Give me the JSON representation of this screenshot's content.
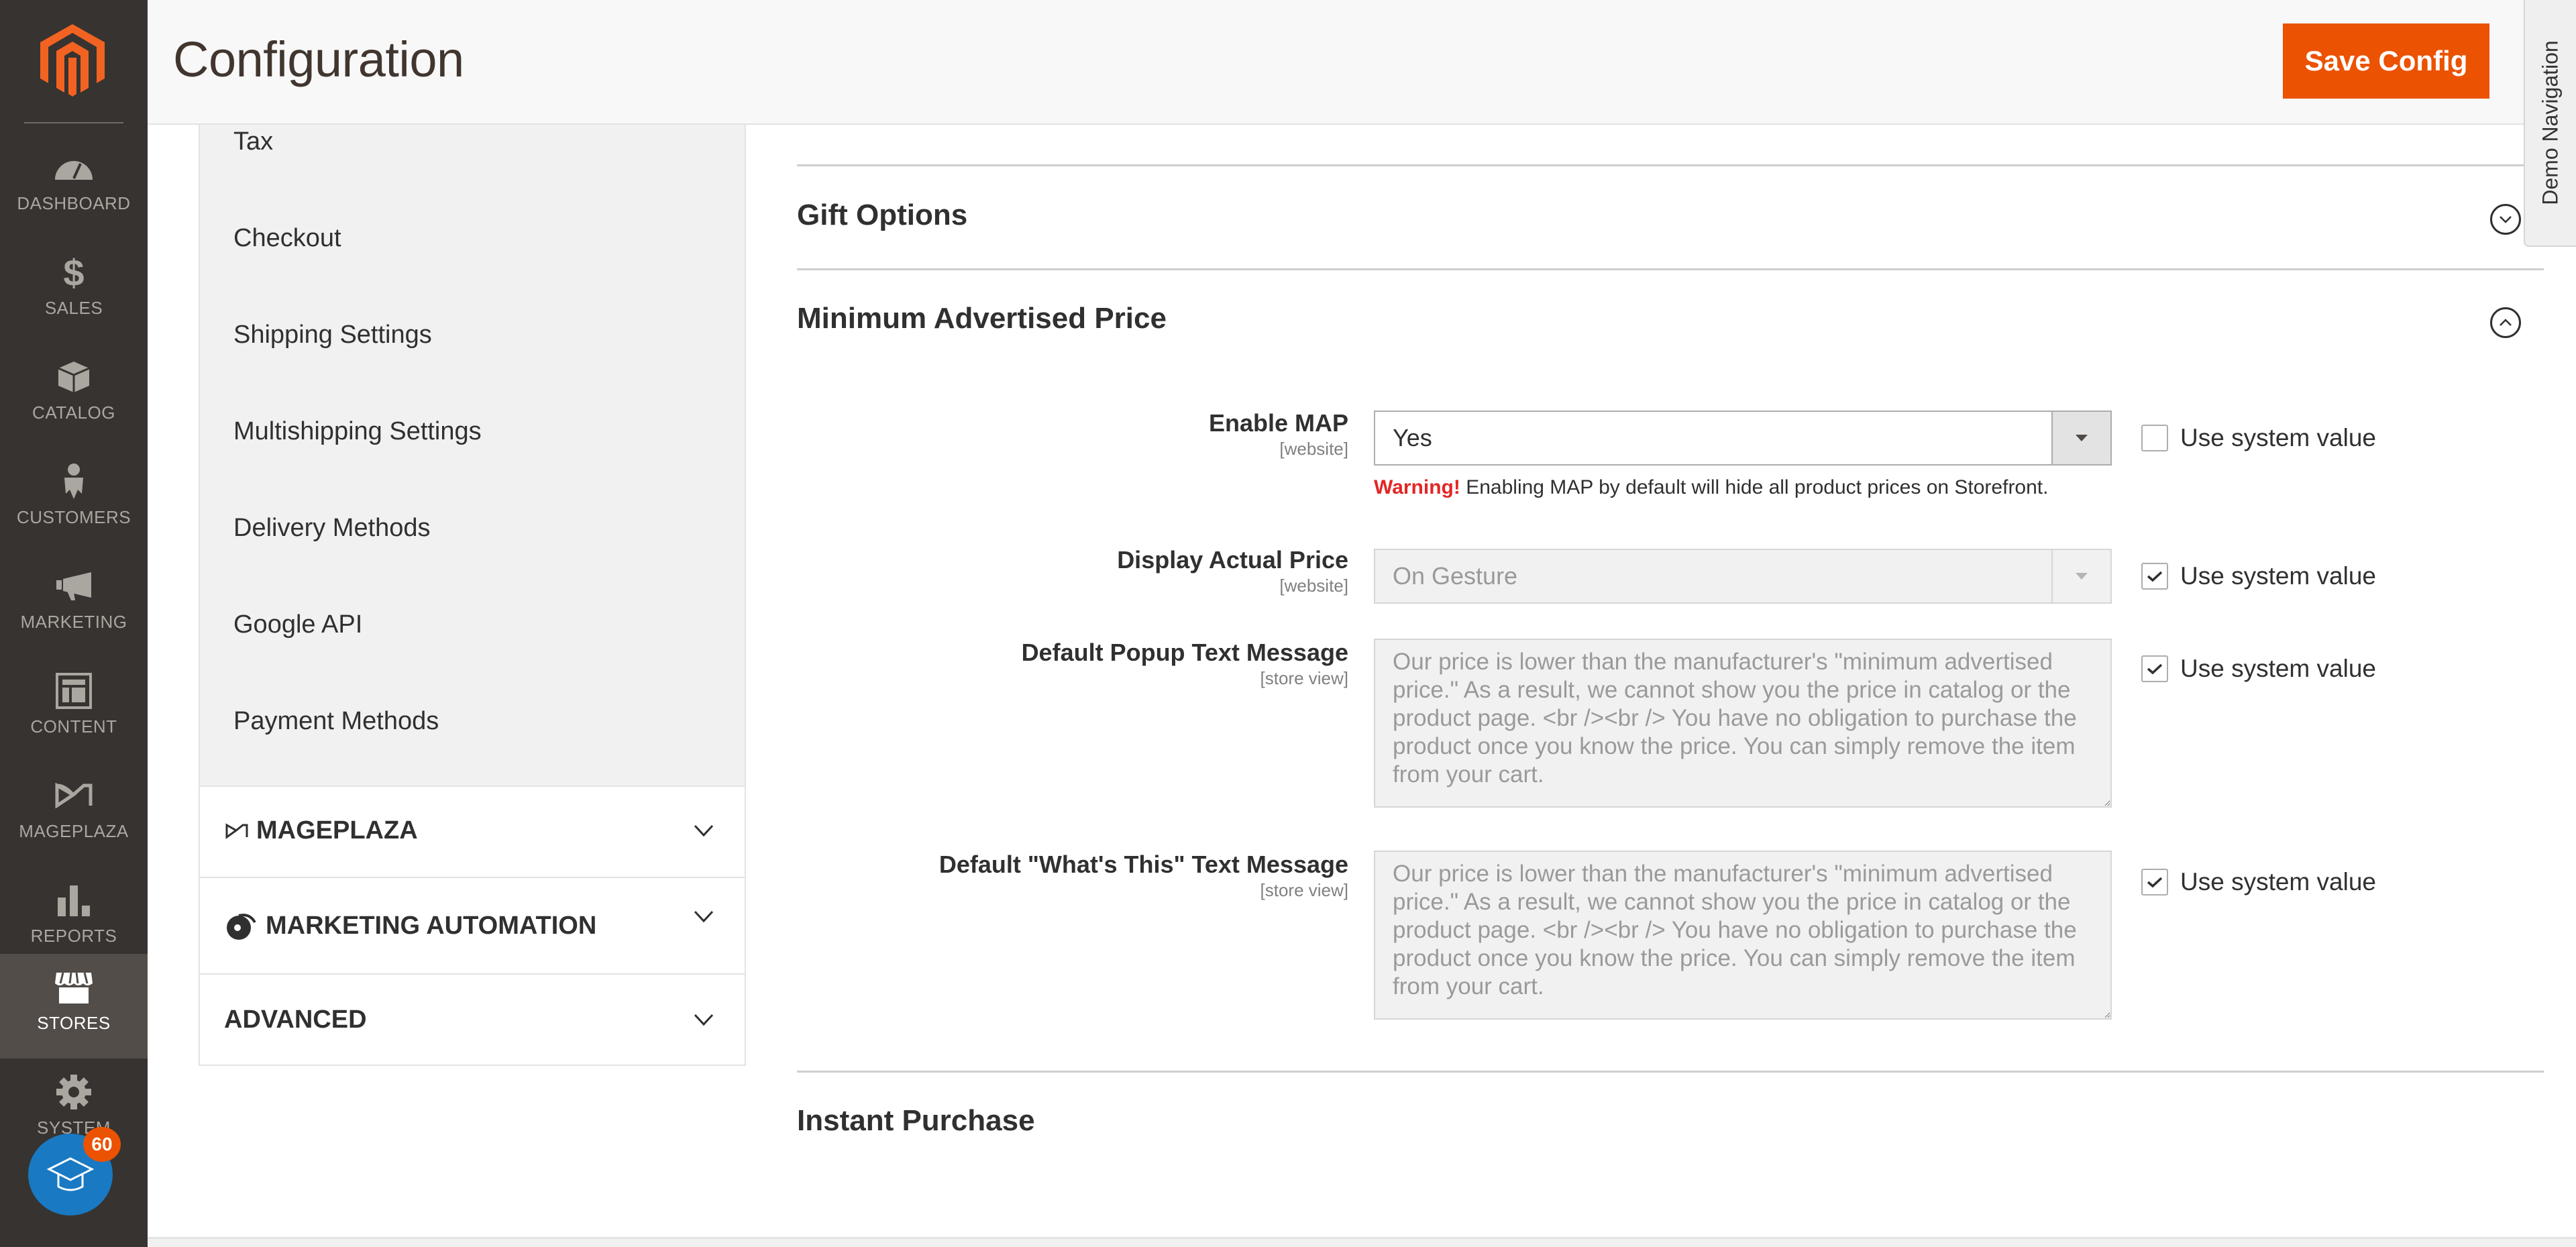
{
  "nav": {
    "items": [
      {
        "label": "DASHBOARD",
        "icon": "dashboard-icon"
      },
      {
        "label": "SALES",
        "icon": "dollar-icon"
      },
      {
        "label": "CATALOG",
        "icon": "box-icon"
      },
      {
        "label": "CUSTOMERS",
        "icon": "person-icon"
      },
      {
        "label": "MARKETING",
        "icon": "megaphone-icon"
      },
      {
        "label": "CONTENT",
        "icon": "layout-icon"
      },
      {
        "label": "MAGEPLAZA",
        "icon": "mageplaza-icon"
      },
      {
        "label": "REPORTS",
        "icon": "bar-chart-icon"
      },
      {
        "label": "STORES",
        "icon": "storefront-icon",
        "active": true
      },
      {
        "label": "SYSTEM",
        "icon": "gear-icon"
      }
    ],
    "notification_count": "60"
  },
  "header": {
    "title": "Configuration",
    "save_label": "Save Config",
    "demo_nav_label": "Demo Navigation"
  },
  "tabs": {
    "sales_links": [
      "Tax",
      "Checkout",
      "Shipping Settings",
      "Multishipping Settings",
      "Delivery Methods",
      "Google API",
      "Payment Methods"
    ],
    "groups": [
      {
        "label": "MAGEPLAZA",
        "icon": "mageplaza-icon"
      },
      {
        "label": "MARKETING AUTOMATION",
        "icon": "dotdigital-icon"
      },
      {
        "label": "ADVANCED",
        "icon": ""
      }
    ]
  },
  "sections": {
    "gift_options": "Gift Options",
    "map": "Minimum Advertised Price",
    "instant_purchase": "Instant Purchase"
  },
  "fields": {
    "enable_map": {
      "label": "Enable MAP",
      "scope": "[website]",
      "value": "Yes",
      "warning_strong": "Warning!",
      "warning_text": " Enabling MAP by default will hide all product prices on Storefront.",
      "use_system": false
    },
    "display_actual_price": {
      "label": "Display Actual Price",
      "scope": "[website]",
      "value": "On Gesture",
      "use_system": true
    },
    "popup_text": {
      "label": "Default Popup Text Message",
      "scope": "[store view]",
      "value": "Our price is lower than the manufacturer's \"minimum advertised price.\" As a result, we cannot show you the price in catalog or the product page. <br /><br /> You have no obligation to purchase the product once you know the price. You can simply remove the item from your cart.",
      "use_system": true
    },
    "whats_this_text": {
      "label": "Default \"What's This\" Text Message",
      "scope": "[store view]",
      "value": "Our price is lower than the manufacturer's \"minimum advertised price.\" As a result, we cannot show you the price in catalog or the product page. <br /><br /> You have no obligation to purchase the product once you know the price. You can simply remove the item from your cart.",
      "use_system": true
    },
    "use_system_label": "Use system value"
  },
  "colors": {
    "accent": "#eb5202",
    "nav_bg": "#373330",
    "warning": "#e22626",
    "notify": "#1979c3"
  }
}
